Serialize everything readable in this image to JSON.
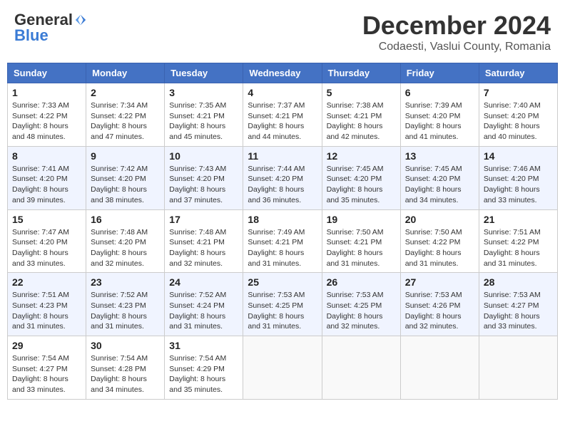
{
  "header": {
    "logo": {
      "general": "General",
      "blue": "Blue",
      "tagline": ""
    },
    "title": "December 2024",
    "location": "Codaesti, Vaslui County, Romania"
  },
  "weekdays": [
    "Sunday",
    "Monday",
    "Tuesday",
    "Wednesday",
    "Thursday",
    "Friday",
    "Saturday"
  ],
  "weeks": [
    [
      {
        "day": 1,
        "sunrise": "7:33 AM",
        "sunset": "4:22 PM",
        "daylight": "8 hours and 48 minutes."
      },
      {
        "day": 2,
        "sunrise": "7:34 AM",
        "sunset": "4:22 PM",
        "daylight": "8 hours and 47 minutes."
      },
      {
        "day": 3,
        "sunrise": "7:35 AM",
        "sunset": "4:21 PM",
        "daylight": "8 hours and 45 minutes."
      },
      {
        "day": 4,
        "sunrise": "7:37 AM",
        "sunset": "4:21 PM",
        "daylight": "8 hours and 44 minutes."
      },
      {
        "day": 5,
        "sunrise": "7:38 AM",
        "sunset": "4:21 PM",
        "daylight": "8 hours and 42 minutes."
      },
      {
        "day": 6,
        "sunrise": "7:39 AM",
        "sunset": "4:20 PM",
        "daylight": "8 hours and 41 minutes."
      },
      {
        "day": 7,
        "sunrise": "7:40 AM",
        "sunset": "4:20 PM",
        "daylight": "8 hours and 40 minutes."
      }
    ],
    [
      {
        "day": 8,
        "sunrise": "7:41 AM",
        "sunset": "4:20 PM",
        "daylight": "8 hours and 39 minutes."
      },
      {
        "day": 9,
        "sunrise": "7:42 AM",
        "sunset": "4:20 PM",
        "daylight": "8 hours and 38 minutes."
      },
      {
        "day": 10,
        "sunrise": "7:43 AM",
        "sunset": "4:20 PM",
        "daylight": "8 hours and 37 minutes."
      },
      {
        "day": 11,
        "sunrise": "7:44 AM",
        "sunset": "4:20 PM",
        "daylight": "8 hours and 36 minutes."
      },
      {
        "day": 12,
        "sunrise": "7:45 AM",
        "sunset": "4:20 PM",
        "daylight": "8 hours and 35 minutes."
      },
      {
        "day": 13,
        "sunrise": "7:45 AM",
        "sunset": "4:20 PM",
        "daylight": "8 hours and 34 minutes."
      },
      {
        "day": 14,
        "sunrise": "7:46 AM",
        "sunset": "4:20 PM",
        "daylight": "8 hours and 33 minutes."
      }
    ],
    [
      {
        "day": 15,
        "sunrise": "7:47 AM",
        "sunset": "4:20 PM",
        "daylight": "8 hours and 33 minutes."
      },
      {
        "day": 16,
        "sunrise": "7:48 AM",
        "sunset": "4:20 PM",
        "daylight": "8 hours and 32 minutes."
      },
      {
        "day": 17,
        "sunrise": "7:48 AM",
        "sunset": "4:21 PM",
        "daylight": "8 hours and 32 minutes."
      },
      {
        "day": 18,
        "sunrise": "7:49 AM",
        "sunset": "4:21 PM",
        "daylight": "8 hours and 31 minutes."
      },
      {
        "day": 19,
        "sunrise": "7:50 AM",
        "sunset": "4:21 PM",
        "daylight": "8 hours and 31 minutes."
      },
      {
        "day": 20,
        "sunrise": "7:50 AM",
        "sunset": "4:22 PM",
        "daylight": "8 hours and 31 minutes."
      },
      {
        "day": 21,
        "sunrise": "7:51 AM",
        "sunset": "4:22 PM",
        "daylight": "8 hours and 31 minutes."
      }
    ],
    [
      {
        "day": 22,
        "sunrise": "7:51 AM",
        "sunset": "4:23 PM",
        "daylight": "8 hours and 31 minutes."
      },
      {
        "day": 23,
        "sunrise": "7:52 AM",
        "sunset": "4:23 PM",
        "daylight": "8 hours and 31 minutes."
      },
      {
        "day": 24,
        "sunrise": "7:52 AM",
        "sunset": "4:24 PM",
        "daylight": "8 hours and 31 minutes."
      },
      {
        "day": 25,
        "sunrise": "7:53 AM",
        "sunset": "4:25 PM",
        "daylight": "8 hours and 31 minutes."
      },
      {
        "day": 26,
        "sunrise": "7:53 AM",
        "sunset": "4:25 PM",
        "daylight": "8 hours and 32 minutes."
      },
      {
        "day": 27,
        "sunrise": "7:53 AM",
        "sunset": "4:26 PM",
        "daylight": "8 hours and 32 minutes."
      },
      {
        "day": 28,
        "sunrise": "7:53 AM",
        "sunset": "4:27 PM",
        "daylight": "8 hours and 33 minutes."
      }
    ],
    [
      {
        "day": 29,
        "sunrise": "7:54 AM",
        "sunset": "4:27 PM",
        "daylight": "8 hours and 33 minutes."
      },
      {
        "day": 30,
        "sunrise": "7:54 AM",
        "sunset": "4:28 PM",
        "daylight": "8 hours and 34 minutes."
      },
      {
        "day": 31,
        "sunrise": "7:54 AM",
        "sunset": "4:29 PM",
        "daylight": "8 hours and 35 minutes."
      },
      null,
      null,
      null,
      null
    ]
  ]
}
